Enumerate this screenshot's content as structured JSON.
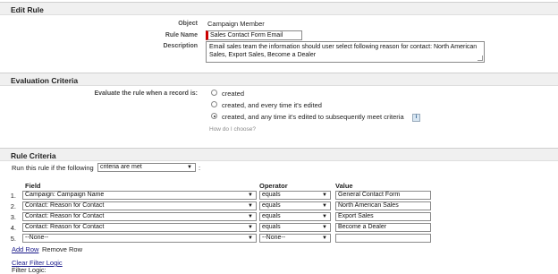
{
  "edit_rule": {
    "header": "Edit Rule",
    "object_label": "Object",
    "object_value": "Campaign Member",
    "rule_name_label": "Rule Name",
    "rule_name_value": "Sales Contact Form Email",
    "description_label": "Description",
    "description_value": "Email sales team the information should user select following reason for contact: North American Sales, Export Sales, Become a Dealer"
  },
  "evaluation": {
    "header": "Evaluation Criteria",
    "prompt": "Evaluate the rule when a record is:",
    "options": [
      {
        "label": "created",
        "checked": false
      },
      {
        "label": "created, and every time it's edited",
        "checked": false
      },
      {
        "label": "created, and any time it's edited to subsequently meet criteria",
        "checked": true
      }
    ],
    "info_icon": "info-icon",
    "help_link": "How do I choose?"
  },
  "criteria": {
    "header": "Rule Criteria",
    "run_if_label": "Run this rule if the following",
    "run_if_value": "criteria are met",
    "run_if_suffix": ":",
    "col_field": "Field",
    "col_operator": "Operator",
    "col_value": "Value",
    "rows": [
      {
        "num": "1.",
        "field": "Campaign: Campaign Name",
        "operator": "equals",
        "value": "General Contact Form"
      },
      {
        "num": "2.",
        "field": "Contact: Reason for Contact",
        "operator": "equals",
        "value": "North American Sales"
      },
      {
        "num": "3.",
        "field": "Contact: Reason for Contact",
        "operator": "equals",
        "value": "Export Sales"
      },
      {
        "num": "4.",
        "field": "Contact: Reason for Contact",
        "operator": "equals",
        "value": "Become a Dealer"
      },
      {
        "num": "5.",
        "field": "--None--",
        "operator": "--None--",
        "value": ""
      }
    ],
    "add_row": "Add Row",
    "remove_row": "Remove Row",
    "clear_filter_logic": "Clear Filter Logic",
    "filter_logic_label": "Filter Logic:"
  }
}
